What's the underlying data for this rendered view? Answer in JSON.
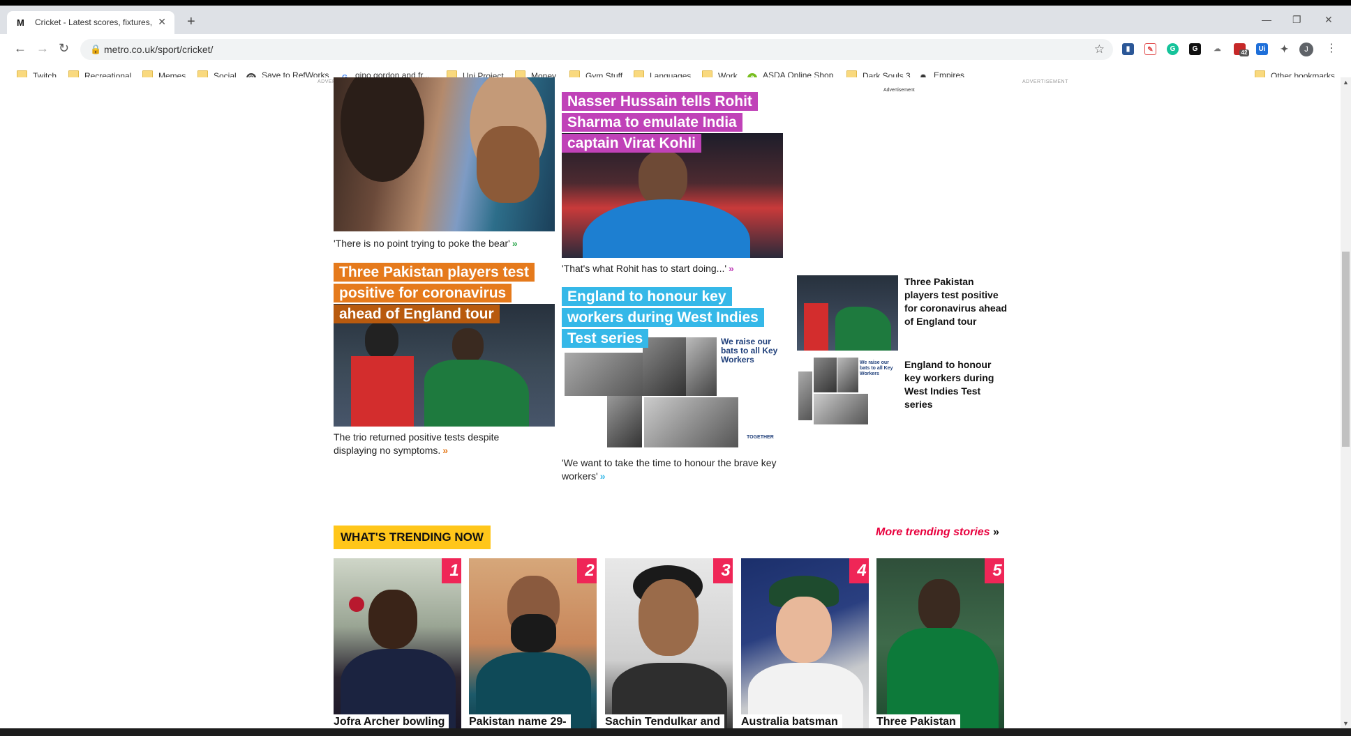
{
  "browser": {
    "tab_title": "Cricket - Latest scores, fixtures, p",
    "favicon_text": "M",
    "url": "metro.co.uk/sport/cricket/",
    "avatar_initial": "J",
    "ext_badge": "42"
  },
  "bookmarks": {
    "items": [
      "Twitch",
      "Recreational",
      "Memes",
      "Social",
      "Save to RefWorks",
      "gino gordon and fr...",
      "Uni Project",
      "Money",
      "Gym Stuff",
      "Languages",
      "Work",
      "ASDA Online Shop",
      "Dark Souls 3",
      "Empires"
    ],
    "other": "Other bookmarks"
  },
  "page": {
    "ad_label_left": "ADVERTISEMENT",
    "ad_label_right": "ADVERTISEMENT",
    "ad_label_mid": "Advertisement",
    "cards": [
      {
        "caption": "'There is no point trying to poke the bear'",
        "chev": "»"
      },
      {
        "headline": [
          "Nasser Hussain tells Rohit",
          "Sharma to emulate India",
          "captain Virat Kohli"
        ],
        "caption": "'That's what Rohit has to start doing...'",
        "chev": "»"
      },
      {
        "headline": [
          "Three Pakistan players test",
          "positive for coronavirus",
          "ahead of England tour"
        ],
        "caption": "The trio returned positive tests despite displaying no symptoms.",
        "chev": "»"
      },
      {
        "headline": [
          "England to honour key",
          "workers during West Indies",
          "Test series"
        ],
        "caption": "'We want to take the time to honour the brave key workers'",
        "chev": "»",
        "poster_text": "We raise our bats to all Key Workers",
        "poster_small": "TOGETHER"
      }
    ],
    "side": [
      {
        "title": "Three Pakistan players test positive for coronavirus ahead of England tour"
      },
      {
        "title": "England to honour key workers during West Indies Test series",
        "poster_text": "We raise our bats to all Key Workers"
      }
    ],
    "trending": {
      "heading": "WHAT'S TRENDING NOW",
      "more": "More trending stories",
      "more_chev": "»",
      "items": [
        {
          "num": "1",
          "caption": "Jofra Archer bowling"
        },
        {
          "num": "2",
          "caption": "Pakistan name 29-"
        },
        {
          "num": "3",
          "caption": "Sachin Tendulkar and"
        },
        {
          "num": "4",
          "caption": "Australia batsman"
        },
        {
          "num": "5",
          "caption": "Three Pakistan"
        }
      ]
    }
  },
  "colors": {
    "pink": "#c042b8",
    "orange": "#e57a1c",
    "blue": "#35b8e8",
    "trend_yellow": "#ffc61a",
    "trend_red": "#ef2657"
  }
}
